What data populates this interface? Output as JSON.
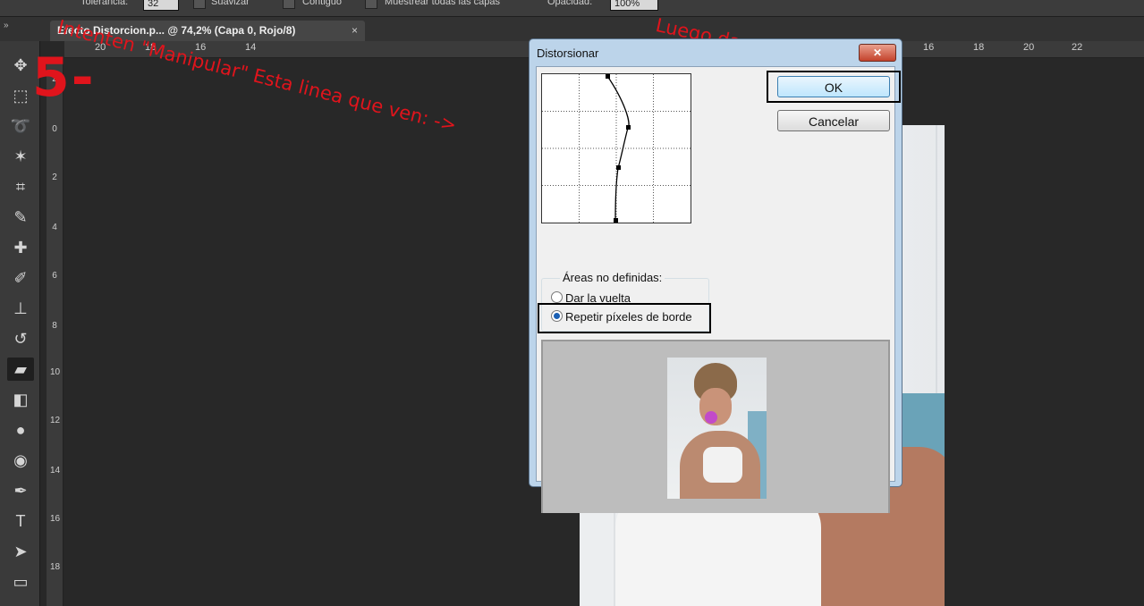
{
  "options_bar": {
    "tolerance_label": "Tolerancia:",
    "tolerance_value": "32",
    "smooth_label": "Suavizar",
    "contiguous_label": "Contiguo",
    "sample_all_label": "Muestrear todas las capas",
    "opacity_label": "Opacidad:",
    "opacity_value": "100%"
  },
  "document_tab": {
    "title": "Efecto Distorcion.p... @ 74,2% (Capa 0, Rojo/8)",
    "close": "×"
  },
  "panel_toggle": "»",
  "rulers": {
    "top": [
      "20",
      "18",
      "16",
      "14",
      "16",
      "18",
      "20",
      "22"
    ],
    "left": [
      "2",
      "0",
      "2",
      "4",
      "6",
      "8",
      "10",
      "12",
      "14",
      "16",
      "18"
    ]
  },
  "tools": [
    {
      "icon": "move-icon",
      "glyph": "✥"
    },
    {
      "icon": "marquee-icon",
      "glyph": "⬚"
    },
    {
      "icon": "lasso-icon",
      "glyph": "➰"
    },
    {
      "icon": "magic-wand-icon",
      "glyph": "✶"
    },
    {
      "icon": "crop-icon",
      "glyph": "⌗"
    },
    {
      "icon": "eyedropper-icon",
      "glyph": "✎"
    },
    {
      "icon": "healing-brush-icon",
      "glyph": "✚"
    },
    {
      "icon": "brush-icon",
      "glyph": "✐"
    },
    {
      "icon": "stamp-icon",
      "glyph": "⊥"
    },
    {
      "icon": "history-brush-icon",
      "glyph": "↺"
    },
    {
      "icon": "eraser-icon",
      "glyph": "▰"
    },
    {
      "icon": "paint-bucket-icon",
      "glyph": "◧"
    },
    {
      "icon": "blur-icon",
      "glyph": "●"
    },
    {
      "icon": "dodge-icon",
      "glyph": "◉"
    },
    {
      "icon": "pen-icon",
      "glyph": "✒"
    },
    {
      "icon": "type-icon",
      "glyph": "T"
    },
    {
      "icon": "path-select-icon",
      "glyph": "➤"
    },
    {
      "icon": "rectangle-icon",
      "glyph": "▭"
    }
  ],
  "annotations": {
    "step": "5-",
    "instruction": "Intenten \"Manipular\" Esta linea que ven: ->",
    "confirm": "Luego dan OK."
  },
  "dialog": {
    "title": "Distorsionar",
    "close_glyph": "✕",
    "ok_label": "OK",
    "cancel_label": "Cancelar",
    "group_label": "Áreas no definidas:",
    "option_wrap": "Dar la vuelta",
    "option_repeat": "Repetir píxeles de borde",
    "selected_option": "Repetir píxeles de borde"
  }
}
